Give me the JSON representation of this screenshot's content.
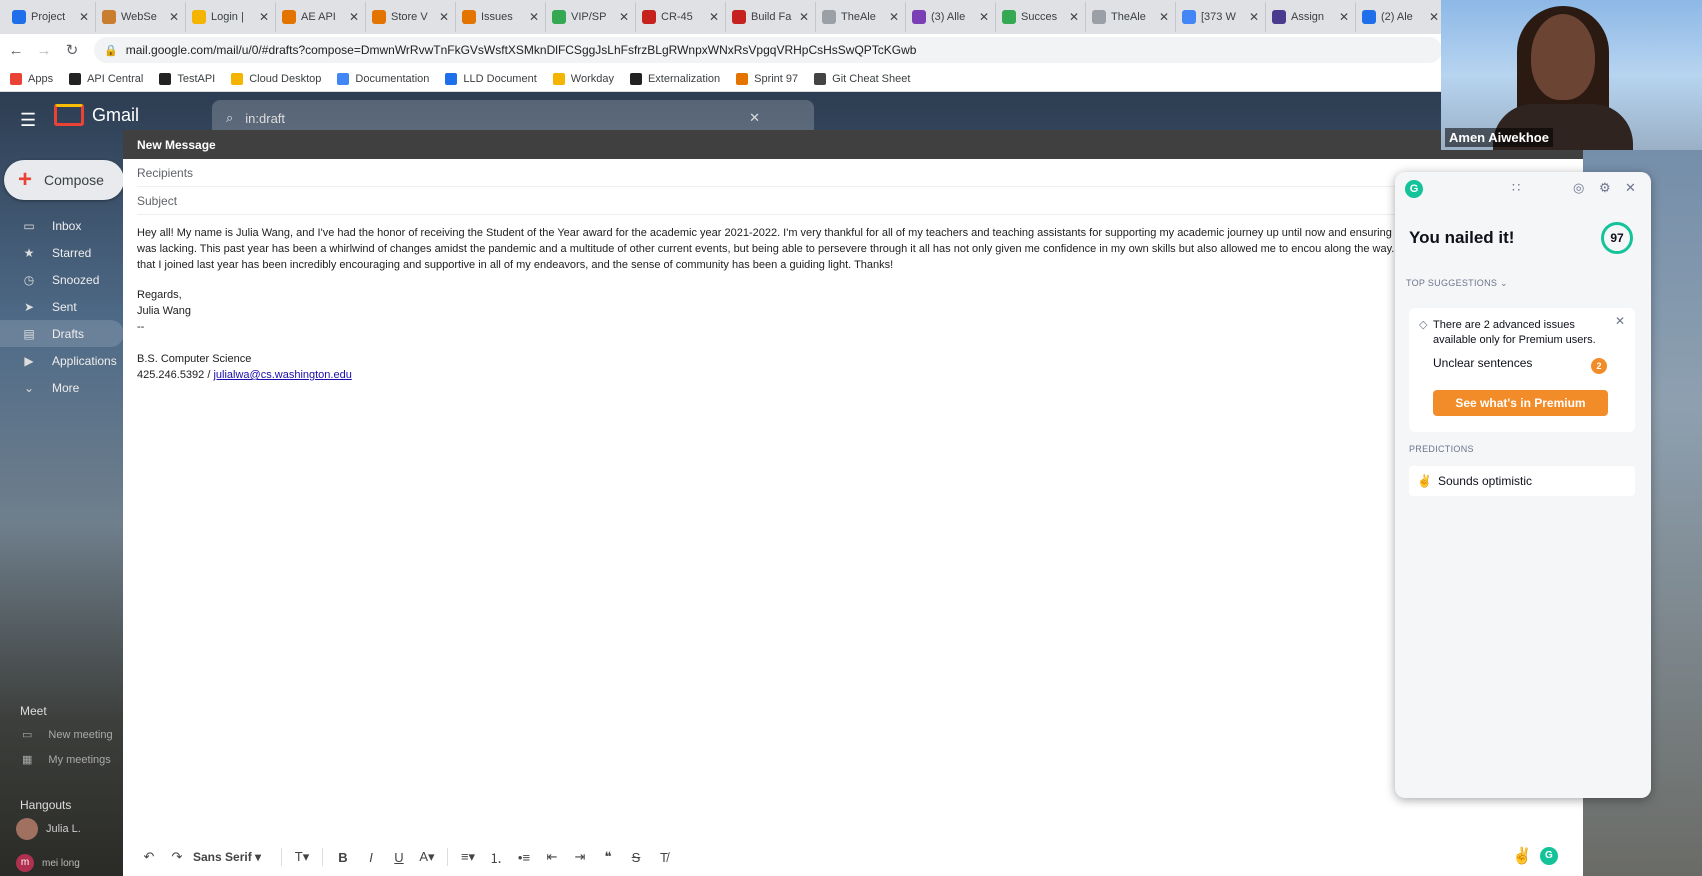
{
  "browser": {
    "tabs": [
      {
        "title": "Project",
        "color": "#1f6feb"
      },
      {
        "title": "WebSe",
        "color": "#c87d2f"
      },
      {
        "title": "Login |",
        "color": "#f4b400"
      },
      {
        "title": "AE API",
        "color": "#e37400"
      },
      {
        "title": "Store V",
        "color": "#e37400"
      },
      {
        "title": "Issues",
        "color": "#e37400"
      },
      {
        "title": "VIP/SP",
        "color": "#34a853"
      },
      {
        "title": "CR-45",
        "color": "#c5221f"
      },
      {
        "title": "Build Fa",
        "color": "#c5221f"
      },
      {
        "title": "TheAle",
        "color": "#9aa0a6"
      },
      {
        "title": "(3) Alle",
        "color": "#7b3fb5"
      },
      {
        "title": "Succes",
        "color": "#34a853"
      },
      {
        "title": "TheAle",
        "color": "#9aa0a6"
      },
      {
        "title": "[373 W",
        "color": "#4285f4"
      },
      {
        "title": "Assign",
        "color": "#4a3b8f"
      },
      {
        "title": "(2) Ale",
        "color": "#1f6feb"
      }
    ],
    "url": "mail.google.com/mail/u/0/#drafts?compose=DmwnWrRvwTnFkGVsWsftXSMknDlFCSggJsLhFsfrzBLgRWnpxWNxRsVpgqVRHpCsHsSwQPTcKGwb",
    "bookmarks": [
      {
        "label": "Apps",
        "color": "#ea4335"
      },
      {
        "label": "API Central",
        "color": "#222"
      },
      {
        "label": "TestAPI",
        "color": "#222"
      },
      {
        "label": "Cloud Desktop",
        "color": "#f4b400"
      },
      {
        "label": "Documentation",
        "color": "#4285f4"
      },
      {
        "label": "LLD Document",
        "color": "#1f6feb"
      },
      {
        "label": "Workday",
        "color": "#f4b400"
      },
      {
        "label": "Externalization",
        "color": "#222"
      },
      {
        "label": "Sprint 97",
        "color": "#e37400"
      },
      {
        "label": "Git Cheat Sheet",
        "color": "#444"
      }
    ]
  },
  "gmail": {
    "logo_text": "Gmail",
    "search_value": "in:draft",
    "compose_label": "Compose",
    "nav": [
      {
        "label": "Inbox",
        "icon": "inbox-icon",
        "glyph": "▭"
      },
      {
        "label": "Starred",
        "icon": "star-icon",
        "glyph": "★"
      },
      {
        "label": "Snoozed",
        "icon": "clock-icon",
        "glyph": "◷"
      },
      {
        "label": "Sent",
        "icon": "send-icon",
        "glyph": "➤"
      },
      {
        "label": "Drafts",
        "icon": "draft-icon",
        "glyph": "▤"
      },
      {
        "label": "Applications",
        "icon": "label-icon",
        "glyph": "▶"
      },
      {
        "label": "More",
        "icon": "chevron-down-icon",
        "glyph": "⌄"
      }
    ],
    "meet_heading": "Meet",
    "meet_new": "New meeting",
    "meet_my": "My meetings",
    "hangouts_heading": "Hangouts",
    "hangouts_user": "Julia L.",
    "contact_initial": "m",
    "contact_name": "mei long"
  },
  "compose": {
    "title": "New Message",
    "recipients_placeholder": "Recipients",
    "subject_placeholder": "Subject",
    "body": "Hey all! My name is Julia Wang, and I've had the honor of receiving the Student of the Year award for the academic year 2021-2022. I'm very thankful for all of my teachers and teaching assistants for supporting my academic journey up until now and ensuring that needed when I felt it was lacking. This past year has been a whirlwind of changes amidst the pandemic and a multitude of other current events, but being able to persevere through it all has not only given me confidence in my own skills but also allowed me to encou along the way. Specifically, the RSO that I joined last year has been incredibly encouraging and supportive in all of my endeavors, and the sense of community has been a guiding light. Thanks!",
    "regards": "Regards,",
    "name": "Julia Wang",
    "dashes": "--",
    "degree": "B.S. Computer Science",
    "phone": "425.246.5392 / ",
    "email": "julialwa@cs.washington.edu",
    "font_name": "Sans Serif"
  },
  "grammarly": {
    "title": "You nailed it!",
    "score": "97",
    "top_suggestions": "TOP SUGGESTIONS",
    "premium_msg": "There are 2 advanced issues available only for Premium users.",
    "unclear": "Unclear sentences",
    "unclear_count": "2",
    "premium_button": "See what's in Premium",
    "predictions": "PREDICTIONS",
    "prediction_item": "Sounds optimistic",
    "accent": "#15c39a",
    "premium_color": "#f28c28"
  },
  "webcam": {
    "name": "Amen Aiwekhoe"
  }
}
